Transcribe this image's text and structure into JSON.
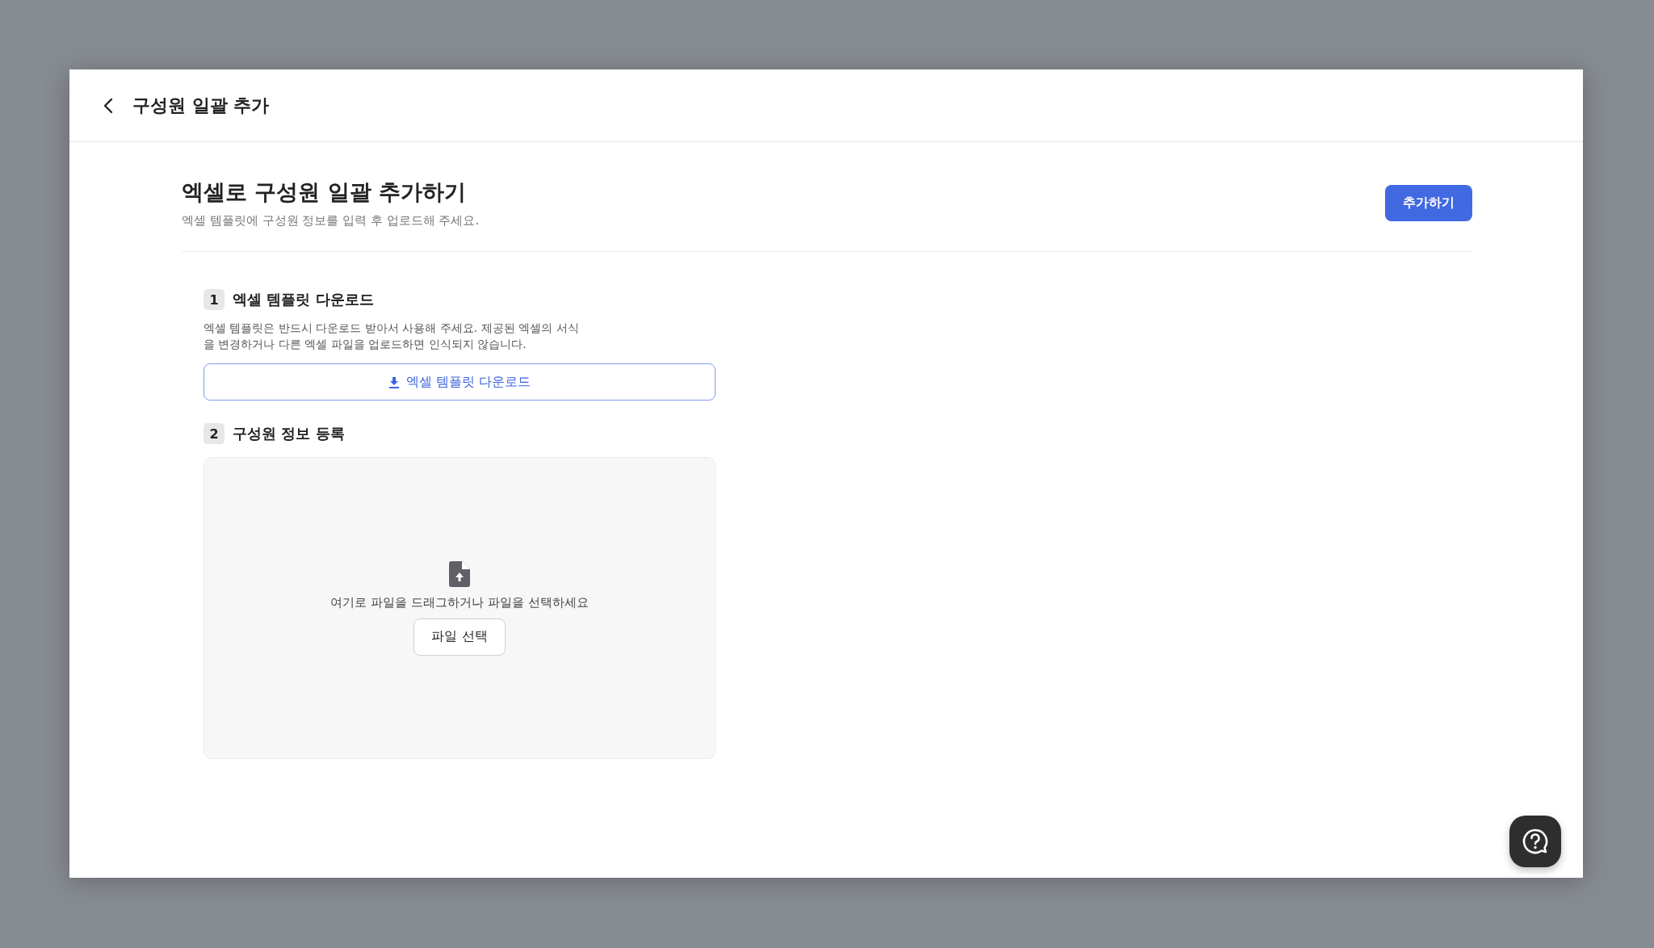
{
  "header": {
    "title": "구성원 일괄 추가"
  },
  "intro": {
    "title": "엑셀로 구성원 일괄 추가하기",
    "subtitle": "엑셀 템플릿에 구성원 정보를 입력 후 업로드해 주세요.",
    "submit_button": "추가하기"
  },
  "steps": [
    {
      "kind": "download",
      "number": "1",
      "title": "엑셀 템플릿 다운로드",
      "description": "엑셀 템플릿은 반드시 다운로드 받아서 사용해 주세요. 제공된 엑셀의 서식을 변경하거나 다른 엑셀 파일을 업로드하면 인식되지 않습니다.",
      "button": "엑셀 템플릿 다운로드"
    },
    {
      "kind": "upload",
      "number": "2",
      "title": "구성원 정보 등록",
      "hint": "여기로 파일을 드래그하거나 파일을 선택하세요",
      "button": "파일 선택"
    }
  ]
}
